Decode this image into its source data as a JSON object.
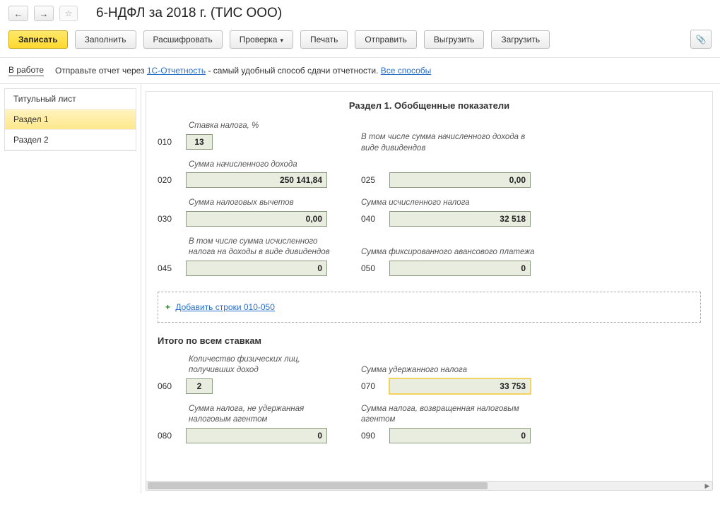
{
  "header": {
    "title": "6-НДФЛ за 2018 г. (ТИС ООО)"
  },
  "toolbar": {
    "save": "Записать",
    "fill": "Заполнить",
    "decode": "Расшифровать",
    "check": "Проверка",
    "print": "Печать",
    "send": "Отправить",
    "export": "Выгрузить",
    "import": "Загрузить"
  },
  "status": {
    "label": "В работе",
    "hint_pre": "Отправьте отчет через ",
    "hint_link1": "1С-Отчетность",
    "hint_post": " - самый удобный способ сдачи отчетности. ",
    "hint_link2": "Все способы"
  },
  "nav": {
    "items": [
      "Титульный лист",
      "Раздел 1",
      "Раздел 2"
    ],
    "active": 1
  },
  "section": {
    "title": "Раздел 1. Обобщенные показатели",
    "tax_rate_label": "Ставка налога, %",
    "tax_rate_code": "010",
    "tax_rate_value": "13",
    "income_label": "Сумма начисленного дохода",
    "income_code": "020",
    "income_value": "250 141,84",
    "dividends_label": "В том числе сумма начисленного дохода в виде дивидендов",
    "dividends_code": "025",
    "dividends_value": "0,00",
    "deductions_label": "Сумма налоговых вычетов",
    "deductions_code": "030",
    "deductions_value": "0,00",
    "calc_tax_label": "Сумма исчисленного налога",
    "calc_tax_code": "040",
    "calc_tax_value": "32 518",
    "div_tax_label": "В том числе сумма исчисленного налога на доходы в виде дивидендов",
    "div_tax_code": "045",
    "div_tax_value": "0",
    "fixed_advance_label": "Сумма фиксированного авансового платежа",
    "fixed_advance_code": "050",
    "fixed_advance_value": "0",
    "add_rows": "Добавить строки 010-050",
    "totals_header": "Итого по всем ставкам",
    "persons_label": "Количество физических лиц, получивших доход",
    "persons_code": "060",
    "persons_value": "2",
    "withheld_label": "Сумма удержанного налога",
    "withheld_code": "070",
    "withheld_value": "33 753",
    "not_withheld_label": "Сумма налога, не удержанная налоговым агентом",
    "not_withheld_code": "080",
    "not_withheld_value": "0",
    "returned_label": "Сумма налога, возвращенная налоговым агентом",
    "returned_code": "090",
    "returned_value": "0"
  }
}
